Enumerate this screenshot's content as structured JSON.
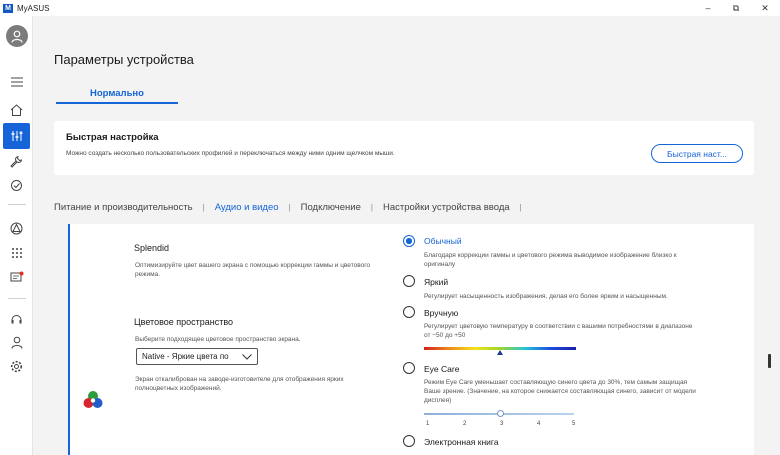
{
  "window": {
    "title": "MyASUS",
    "logo_text": "M",
    "controls": {
      "minimize": "–",
      "maximize": "⧉",
      "close": "✕"
    }
  },
  "sidebar": {
    "icons": [
      "avatar-icon",
      "menu-icon",
      "home-icon",
      "sliders-icon",
      "wrench-icon",
      "refresh-icon",
      "network-icon",
      "apps-icon",
      "message-icon",
      "support-icon",
      "user-icon",
      "settings-icon"
    ],
    "active": "sliders-icon"
  },
  "header": {
    "title": "Параметры устройства",
    "tab": "Нормально"
  },
  "quick": {
    "title": "Быстрая настройка",
    "desc": "Можно создать несколько пользовательских профилей и переключаться между ними одним щелчком мыши.",
    "button": "Быстрая наст..."
  },
  "categories": [
    "Питание и производительность",
    "Аудио и видео",
    "Подключение",
    "Настройки устройства ввода"
  ],
  "active_category": "Аудио и видео",
  "splendid": {
    "title": "Splendid",
    "desc": "Оптимизируйте цвет вашего экрана с помощью коррекции гаммы и цветового режима.",
    "options": [
      {
        "label": "Обычный",
        "desc": "Благодаря коррекции гаммы и цветового режима выводимое изображение близко к оригиналу",
        "checked": true
      },
      {
        "label": "Яркий",
        "desc": "Регулирует насыщенность изображения, делая его более ярким и насыщенным.",
        "checked": false
      },
      {
        "label": "Вручную",
        "desc": "Регулирует цветовую температуру в соответствии с вашими потребностями в диапазоне от −50 до +50",
        "checked": false
      },
      {
        "label": "Eye Care",
        "desc": "Режим Eye Care уменьшает составляющую синего цвета до 30%, тем самым защищая Ваше зрение. (Значение, на которое снижается составляющая синего, зависит от модели дисплея)",
        "checked": false
      },
      {
        "label": "Электронная книга",
        "desc": "",
        "checked": false
      }
    ],
    "manual_level": 0.5,
    "eye_care": {
      "ticks": [
        "1",
        "2",
        "3",
        "4",
        "5"
      ],
      "value": 3
    }
  },
  "color_space": {
    "title": "Цветовое пространство",
    "desc": "Выберите подходящее цветовое пространство экрана.",
    "select_value": "Native - Яркие цвета по",
    "calibrated_note": "Экран откалиброван на заводе-изготовителе для отображения ярких полноцветных изображений."
  },
  "colors": {
    "accent": "#1565d8",
    "background": "#f3f3f3",
    "card": "#ffffff"
  }
}
